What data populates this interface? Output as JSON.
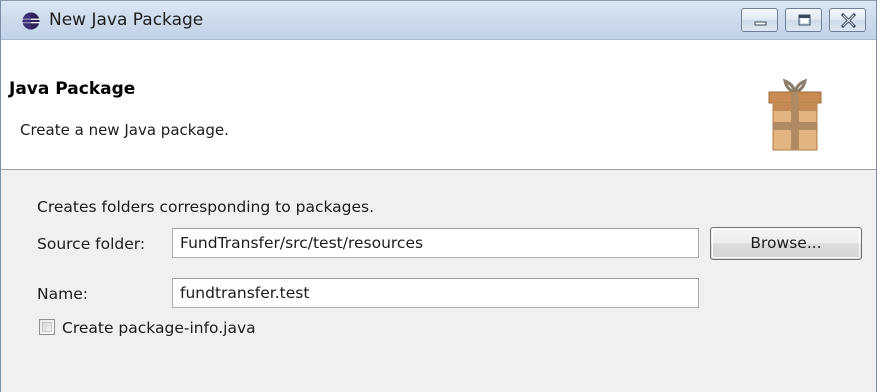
{
  "window": {
    "title": "New Java Package"
  },
  "title_controls": {
    "minimize": "minimize",
    "maximize": "maximize",
    "close": "close"
  },
  "banner": {
    "title": "Java Package",
    "subtitle": "Create a new Java package.",
    "icon": "package-gift-icon"
  },
  "form": {
    "description": "Creates folders corresponding to packages.",
    "source_folder_label": "Source folder:",
    "source_folder_value": "FundTransfer/src/test/resources",
    "browse_label": "Browse...",
    "name_label": "Name:",
    "name_value": "fundtransfer.test",
    "create_package_info_label": "Create package-info.java",
    "create_package_info_checked": false
  }
}
